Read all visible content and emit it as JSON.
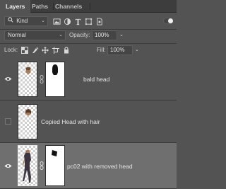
{
  "tabs": [
    {
      "label": "Layers",
      "active": true
    },
    {
      "label": "Paths",
      "active": false
    },
    {
      "label": "Channels",
      "active": false
    }
  ],
  "filter": {
    "kind_label": "Kind",
    "filter_icons": [
      "pixel-filter-icon",
      "adjustment-filter-icon",
      "type-filter-icon",
      "shape-filter-icon",
      "smart-object-filter-icon"
    ],
    "toggle_on": true
  },
  "blend": {
    "mode": "Normal",
    "opacity_label": "Opacity:",
    "opacity_value": "100%"
  },
  "lock": {
    "label": "Lock:",
    "icons": [
      "lock-transparent-icon",
      "lock-image-icon",
      "lock-position-icon",
      "lock-artboard-icon",
      "lock-all-icon"
    ],
    "fill_label": "Fill:",
    "fill_value": "100%"
  },
  "layers": [
    {
      "name": "bald head",
      "visible": true,
      "selected": false,
      "has_mask": true
    },
    {
      "name": "Copied Head with hair",
      "visible": false,
      "selected": false,
      "has_mask": false
    },
    {
      "name": "pc02 with removed head",
      "visible": true,
      "selected": true,
      "has_mask": true
    }
  ],
  "colors": {
    "panel_bg": "#535353",
    "tabbar_bg": "#3d3d3d",
    "selected_row": "#6f6f6f"
  }
}
